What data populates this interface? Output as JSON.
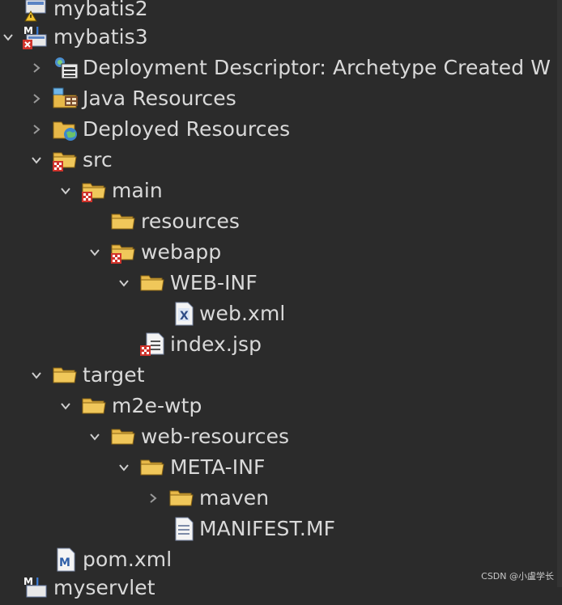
{
  "tree": {
    "items": [
      {
        "label": "mybatis2",
        "icon": "maven-project-warning-icon"
      },
      {
        "label": "mybatis3",
        "icon": "maven-project-error-icon"
      },
      {
        "label": "Deployment Descriptor: Archetype Created W",
        "icon": "deployment-descriptor-icon"
      },
      {
        "label": "Java Resources",
        "icon": "java-resources-icon"
      },
      {
        "label": "Deployed Resources",
        "icon": "deployed-resources-icon"
      },
      {
        "label": "src",
        "icon": "folder-error-icon"
      },
      {
        "label": "main",
        "icon": "folder-error-icon"
      },
      {
        "label": "resources",
        "icon": "folder-icon"
      },
      {
        "label": "webapp",
        "icon": "folder-error-icon"
      },
      {
        "label": "WEB-INF",
        "icon": "folder-icon"
      },
      {
        "label": "web.xml",
        "icon": "xml-file-icon"
      },
      {
        "label": "index.jsp",
        "icon": "jsp-file-error-icon"
      },
      {
        "label": "target",
        "icon": "folder-icon"
      },
      {
        "label": "m2e-wtp",
        "icon": "folder-icon"
      },
      {
        "label": "web-resources",
        "icon": "folder-icon"
      },
      {
        "label": "META-INF",
        "icon": "folder-icon"
      },
      {
        "label": "maven",
        "icon": "folder-icon"
      },
      {
        "label": "MANIFEST.MF",
        "icon": "text-file-icon"
      },
      {
        "label": "pom.xml",
        "icon": "maven-pom-icon"
      },
      {
        "label": "myservlet",
        "icon": "maven-project-icon"
      }
    ]
  },
  "watermark": "CSDN @小盧学长"
}
